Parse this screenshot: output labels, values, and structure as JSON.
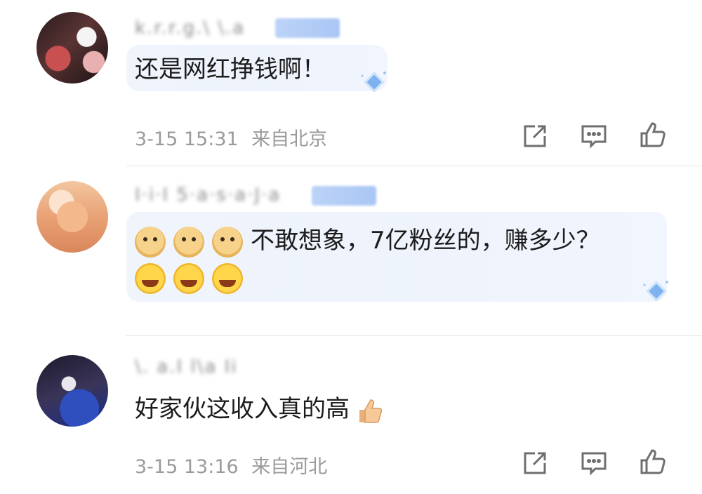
{
  "comments": [
    {
      "username": "k.r.r.g.\\ \\.a",
      "text": "还是网红挣钱啊！",
      "date": "3-15 15:31",
      "location": "来自北京",
      "avatar_icon": "user-avatar",
      "actions": [
        "share-icon",
        "comment-icon",
        "like-icon"
      ]
    },
    {
      "username": "I·i·I  5·a·s·a·J·a",
      "emojis_prefix": [
        "doge-emoji",
        "doge-emoji",
        "doge-emoji"
      ],
      "text": "不敢想象，7亿粉丝的，赚多少？",
      "emojis_suffix": [
        "laughing-crying-emoji",
        "laughing-crying-emoji",
        "laughing-crying-emoji"
      ],
      "avatar_icon": "user-avatar"
    },
    {
      "username": "\\.  a.I  l\\a  Ii",
      "text": "好家伙这收入真的高",
      "trailing_emoji": "thumbs-up-emoji",
      "date": "3-15 13:16",
      "location": "来自河北",
      "avatar_icon": "user-avatar",
      "actions": [
        "share-icon",
        "comment-icon",
        "like-icon"
      ]
    }
  ],
  "colors": {
    "bubble": "#eef3fc",
    "meta_text": "#9a9a9a",
    "badge": "#a9c6f5",
    "icon_stroke": "#6f6f6f"
  }
}
